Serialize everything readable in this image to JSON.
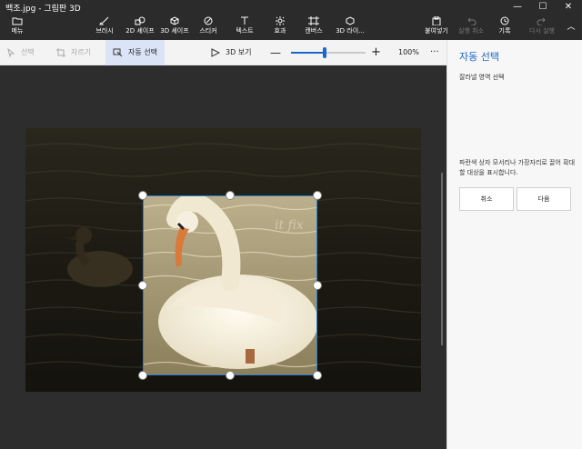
{
  "window": {
    "title": "백조.jpg - 그림판 3D"
  },
  "ribbon": {
    "menu": "메뉴",
    "brush": "브러시",
    "shapes2d": "2D 셰이프",
    "shapes3d": "3D 셰이프",
    "stickers": "스티커",
    "text": "텍스트",
    "effects": "효과",
    "canvas": "캔버스",
    "library3d": "3D 라이...",
    "paste": "붙여넣기",
    "undo": "실행 취소",
    "history": "기록",
    "redo": "다시 실행"
  },
  "toolbar": {
    "select": "선택",
    "crop": "자르기",
    "auto_select": "자동 선택",
    "view3d": "3D 보기",
    "zoom_percent": "100%",
    "zoom_level": 0.45
  },
  "panel": {
    "title": "자동 선택",
    "subtitle": "잘라낼 영역 선택",
    "help": "파란색 상자 모서리나 가장자리로 끌어 확대할 대상을 표시합니다.",
    "cancel": "취소",
    "next": "다음"
  },
  "photo": {
    "watermark": "it fix"
  }
}
